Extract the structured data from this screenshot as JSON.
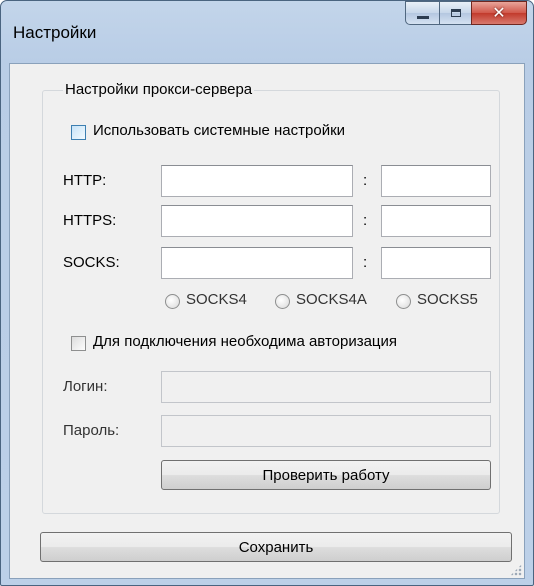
{
  "window": {
    "title": "Настройки"
  },
  "proxy_group": {
    "legend": "Настройки прокси-сервера",
    "use_system_label": "Использовать системные настройки",
    "http_label": "HTTP:",
    "https_label": "HTTPS:",
    "socks_label": "SOCKS:",
    "colon": ":",
    "http_host": "",
    "http_port": "",
    "https_host": "",
    "https_port": "",
    "socks_host": "",
    "socks_port": "",
    "socks_versions": [
      "SOCKS4",
      "SOCKS4A",
      "SOCKS5"
    ],
    "auth_label": "Для подключения необходима авторизация",
    "login_label": "Логин:",
    "password_label": "Пароль:",
    "login_value": "",
    "password_value": "",
    "test_button": "Проверить работу"
  },
  "save_button": "Сохранить"
}
